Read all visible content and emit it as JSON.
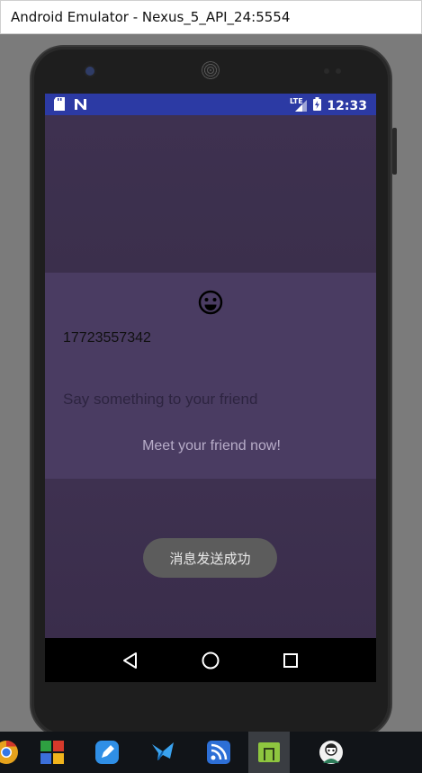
{
  "window": {
    "title": "Android Emulator - Nexus_5_API_24:5554"
  },
  "statusbar": {
    "left_icons": [
      "sd-card-icon",
      "n-notification-icon"
    ],
    "network": "LTE",
    "time": "12:33"
  },
  "dialog": {
    "emoji": "☺",
    "phone_number": "17723557342",
    "message_placeholder": "Say something to your friend",
    "meet_button_label": "Meet your friend now!"
  },
  "toast": {
    "text": "消息发送成功"
  },
  "navbar": {
    "items": [
      "back-icon",
      "home-icon",
      "recents-icon"
    ]
  },
  "taskbar": {
    "items": [
      "chrome-icon",
      "windows-store-icon",
      "pen-icon",
      "feather-icon",
      "rss-icon",
      "android-icon",
      "avatar-icon"
    ]
  },
  "colors": {
    "statusbar": "#2c3aa4",
    "dialog": "#4a3c62",
    "dim": "#3e3150",
    "toast": "#5c5c5c"
  }
}
